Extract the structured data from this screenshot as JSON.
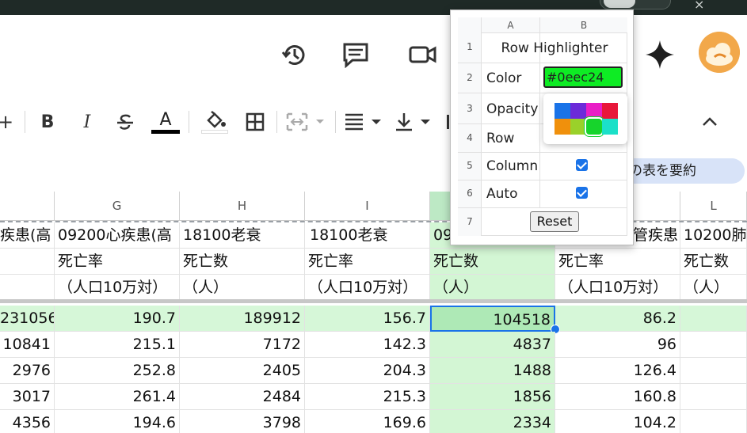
{
  "header": {
    "icons": [
      "history-icon",
      "comment-icon",
      "video-call-icon",
      "gemini-sparkle-icon",
      "avatar"
    ]
  },
  "toolbar": {
    "items": [
      "plus-icon",
      "bold-icon",
      "italic-icon",
      "strikethrough-icon",
      "text-color-icon",
      "fill-color-icon",
      "borders-icon",
      "merge-cells-icon",
      "align-icon",
      "valign-icon",
      "collapse-toolbar-icon"
    ],
    "bold_label": "B",
    "italic_label": "I",
    "text_color_label": "A",
    "plus_label": "+"
  },
  "search_chip": {
    "label": "の表を要約"
  },
  "sheet": {
    "column_headers": [
      "G",
      "H",
      "I",
      "",
      "",
      "L"
    ],
    "header_rows": [
      [
        "疾患(高",
        "09200心疾患(高",
        "18100老衰",
        "18100老衰",
        "09",
        "管疾患",
        "10200肺"
      ],
      [
        "",
        "死亡率",
        "死亡数",
        "死亡率",
        "死亡数",
        "死亡率",
        "死亡数"
      ],
      [
        "",
        "（人口10万対）",
        "（人）",
        "（人口10万対）",
        "（人）",
        "（人口10万対）",
        "（人）"
      ]
    ],
    "data_rows": [
      [
        "231056",
        "190.7",
        "189912",
        "156.7",
        "104518",
        "86.2",
        ""
      ],
      [
        "10841",
        "215.1",
        "7172",
        "142.3",
        "4837",
        "96",
        ""
      ],
      [
        "2976",
        "252.8",
        "2405",
        "204.3",
        "1488",
        "126.4",
        ""
      ],
      [
        "3017",
        "261.4",
        "2484",
        "215.3",
        "1856",
        "160.8",
        ""
      ],
      [
        "4356",
        "194.6",
        "3798",
        "169.6",
        "2334",
        "104.2",
        ""
      ]
    ]
  },
  "popup": {
    "col_a": "A",
    "col_b": "B",
    "title": "Row Highlighter",
    "rows": [
      {
        "n": "1"
      },
      {
        "n": "2",
        "label": "Color"
      },
      {
        "n": "3",
        "label": "Opacity"
      },
      {
        "n": "4",
        "label": "Row"
      },
      {
        "n": "5",
        "label": "Column",
        "checked": true
      },
      {
        "n": "6",
        "label": "Auto",
        "checked": true
      },
      {
        "n": "7"
      }
    ],
    "color_value": "#0eec24",
    "palette": [
      "#1a73e8",
      "#6c2bd9",
      "#e91ec6",
      "#e8173a",
      "#f0900c",
      "#9ad12a",
      "#17d42c",
      "#1be0c8"
    ],
    "reset_label": "Reset"
  },
  "colors": {
    "highlight": "#0eec24",
    "highlight_bg": "#d6f7d8"
  }
}
